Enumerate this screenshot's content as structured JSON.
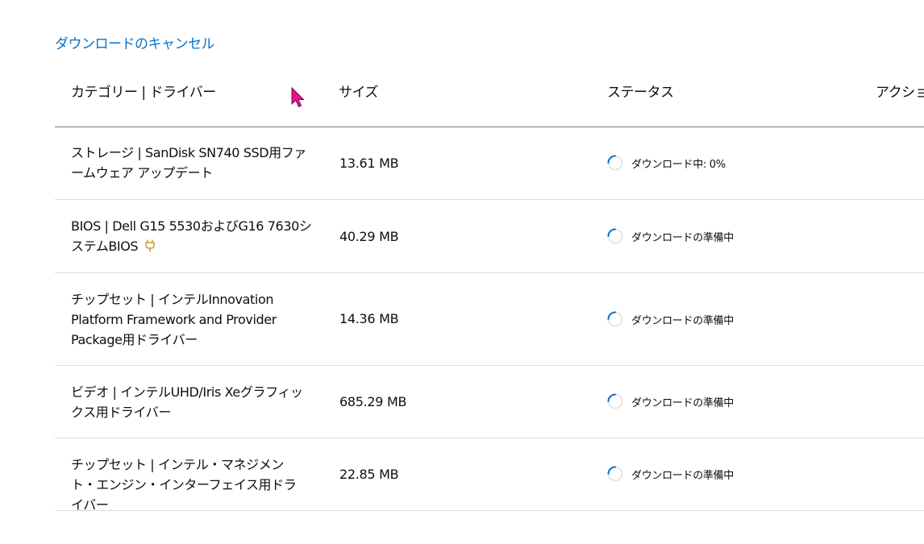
{
  "cancel_link": "ダウンロードのキャンセル",
  "headers": {
    "category": "カテゴリー | ドライバー",
    "size": "サイズ",
    "status": "ステータス",
    "action": "アクション"
  },
  "rows": [
    {
      "category": "ストレージ | SanDisk SN740 SSD用ファームウェア アップデート",
      "size": "13.61 MB",
      "status": "ダウンロード中: 0%"
    },
    {
      "category": "BIOS | Dell G15 5530およびG16 7630システムBIOS",
      "size": "40.29 MB",
      "status": "ダウンロードの準備中",
      "icon": "plug-icon"
    },
    {
      "category": "チップセット | インテルInnovation Platform Framework and Provider Package用ドライバー",
      "size": "14.36 MB",
      "status": "ダウンロードの準備中"
    },
    {
      "category": "ビデオ | インテルUHD/Iris Xeグラフィックス用ドライバー",
      "size": "685.29 MB",
      "status": "ダウンロードの準備中"
    },
    {
      "category": "チップセット | インテル・マネジメント・エンジン・インターフェイス用ドライバー",
      "size": "22.85 MB",
      "status": "ダウンロードの準備中"
    }
  ],
  "colors": {
    "link": "#0672cb",
    "spinner": "#0672cb",
    "cursor": "#e0188c",
    "plug_icon": "#c59a2e"
  }
}
